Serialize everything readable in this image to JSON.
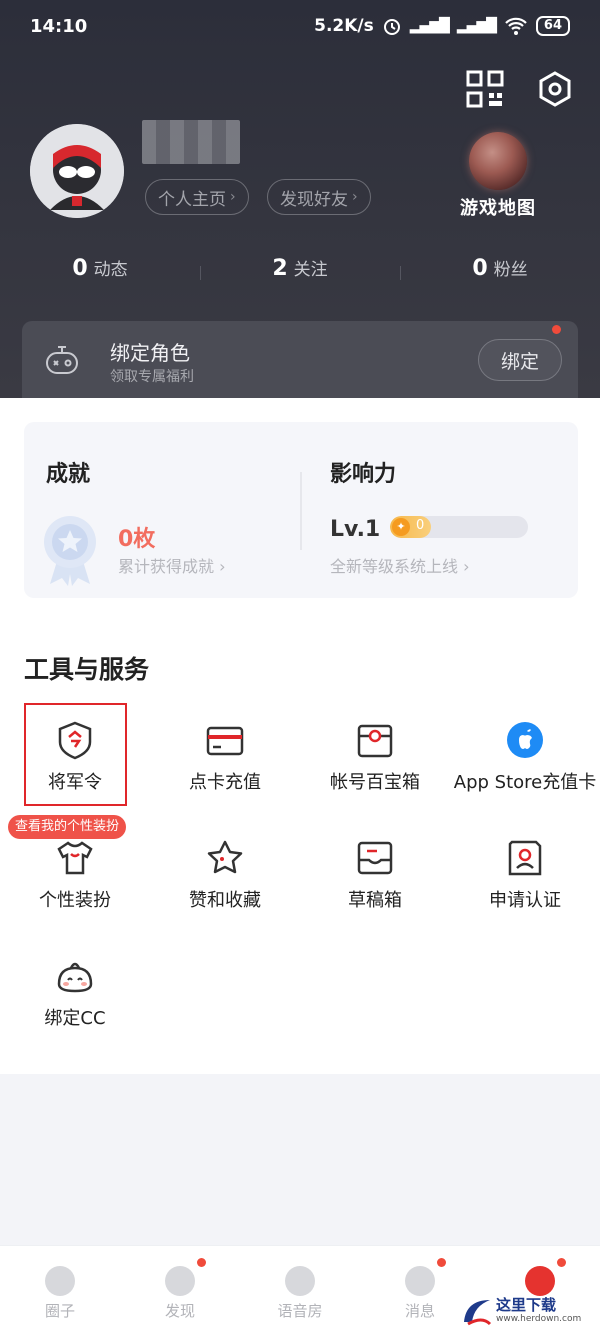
{
  "status_bar": {
    "time": "14:10",
    "speed": "5.2K/s",
    "battery": "64"
  },
  "profile": {
    "home_label": "个人主页",
    "find_friends_label": "发现好友",
    "game_map_label": "游戏地图"
  },
  "stats": [
    {
      "count": "0",
      "label": "动态"
    },
    {
      "count": "2",
      "label": "关注"
    },
    {
      "count": "0",
      "label": "粉丝"
    }
  ],
  "bind_role": {
    "title": "绑定角色",
    "subtitle": "领取专属福利",
    "button": "绑定"
  },
  "achievement": {
    "title": "成就",
    "count": "0枚",
    "subtitle": "累计获得成就"
  },
  "influence": {
    "title": "影响力",
    "level": "Lv.1",
    "points": "0",
    "progress": 0.3,
    "subtitle": "全新等级系统上线"
  },
  "tools": {
    "title": "工具与服务",
    "items": [
      {
        "label": "将军令",
        "icon": "shield-token-icon"
      },
      {
        "label": "点卡充值",
        "icon": "card-icon"
      },
      {
        "label": "帐号百宝箱",
        "icon": "treasure-box-icon"
      },
      {
        "label": "App Store充值卡",
        "icon": "app-store-icon"
      },
      {
        "label": "个性装扮",
        "icon": "tshirt-icon"
      },
      {
        "label": "赞和收藏",
        "icon": "star-icon"
      },
      {
        "label": "草稿箱",
        "icon": "draft-box-icon"
      },
      {
        "label": "申请认证",
        "icon": "verify-id-icon"
      },
      {
        "label": "绑定CC",
        "icon": "cc-mascot-icon"
      }
    ],
    "tooltip": "查看我的个性装扮"
  },
  "nav": [
    {
      "label": "圈子",
      "badge": false
    },
    {
      "label": "发现",
      "badge": true
    },
    {
      "label": "语音房",
      "badge": false
    },
    {
      "label": "消息",
      "badge": true
    },
    {
      "label": "",
      "badge": true
    }
  ],
  "watermark": {
    "title": "这里下载",
    "url": "www.herdown.com"
  },
  "colors": {
    "accent": "#e0262a",
    "header_bg": "#2c2e3a",
    "achievement_count": "#f26d5f"
  }
}
